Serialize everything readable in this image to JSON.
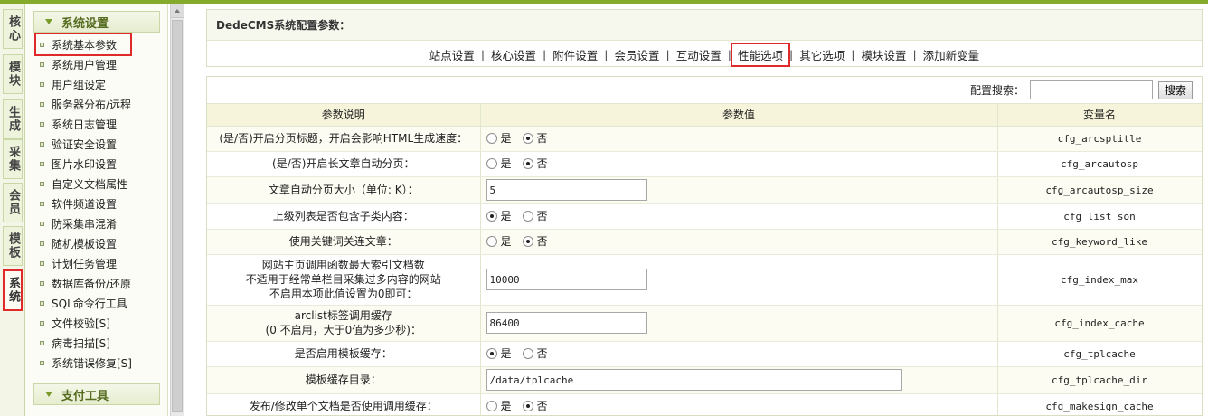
{
  "vtabs": [
    {
      "label": "核心",
      "active": false
    },
    {
      "label": "模块",
      "active": false
    },
    {
      "label": "生成",
      "active": false
    },
    {
      "label": "采集",
      "active": false
    },
    {
      "label": "会员",
      "active": false
    },
    {
      "label": "模板",
      "active": false
    },
    {
      "label": "系统",
      "active": true
    }
  ],
  "sidebar": {
    "section_title": "系统设置",
    "items": [
      {
        "label": "系统基本参数"
      },
      {
        "label": "系统用户管理"
      },
      {
        "label": "用户组设定"
      },
      {
        "label": "服务器分布/远程"
      },
      {
        "label": "系统日志管理"
      },
      {
        "label": "验证安全设置"
      },
      {
        "label": "图片水印设置"
      },
      {
        "label": "自定义文档属性"
      },
      {
        "label": "软件频道设置"
      },
      {
        "label": "防采集串混淆"
      },
      {
        "label": "随机模板设置"
      },
      {
        "label": "计划任务管理"
      },
      {
        "label": "数据库备份/还原"
      },
      {
        "label": "SQL命令行工具"
      },
      {
        "label": "文件校验[S]"
      },
      {
        "label": "病毒扫描[S]"
      },
      {
        "label": "系统错误修复[S]"
      }
    ],
    "section2_title": "支付工具"
  },
  "main": {
    "title": "DedeCMS系统配置参数：",
    "tabs": [
      {
        "label": "站点设置"
      },
      {
        "label": "核心设置"
      },
      {
        "label": "附件设置"
      },
      {
        "label": "会员设置"
      },
      {
        "label": "互动设置"
      },
      {
        "label": "性能选项"
      },
      {
        "label": "其它选项"
      },
      {
        "label": "模块设置"
      },
      {
        "label": "添加新变量"
      }
    ],
    "search_label": "配置搜索：",
    "search_value": "",
    "search_button": "搜索",
    "columns": [
      "参数说明",
      "参数值",
      "变量名"
    ],
    "radio_yes": "是",
    "radio_no": "否",
    "rows": [
      {
        "desc": [
          "(是/否)开启分页标题，开启会影响HTML生成速度："
        ],
        "type": "radio",
        "value": "否",
        "var": "cfg_arcsptitle"
      },
      {
        "desc": [
          "(是/否)开启长文章自动分页："
        ],
        "type": "radio",
        "value": "否",
        "var": "cfg_arcautosp"
      },
      {
        "desc": [
          "文章自动分页大小（单位: K）："
        ],
        "type": "text",
        "value": "5",
        "var": "cfg_arcautosp_size"
      },
      {
        "desc": [
          "上级列表是否包含子类内容："
        ],
        "type": "radio",
        "value": "是",
        "var": "cfg_list_son"
      },
      {
        "desc": [
          "使用关键词关连文章："
        ],
        "type": "radio",
        "value": "否",
        "var": "cfg_keyword_like"
      },
      {
        "desc": [
          "网站主页调用函数最大索引文档数",
          "不适用于经常单栏目采集过多内容的网站",
          "不启用本项此值设置为0即可："
        ],
        "type": "text",
        "value": "10000",
        "var": "cfg_index_max"
      },
      {
        "desc": [
          "arclist标签调用缓存",
          "(0 不启用，大于0值为多少秒)："
        ],
        "type": "text",
        "value": "86400",
        "var": "cfg_index_cache"
      },
      {
        "desc": [
          "是否启用模板缓存："
        ],
        "type": "radio",
        "value": "是",
        "var": "cfg_tplcache"
      },
      {
        "desc": [
          "模板缓存目录："
        ],
        "type": "textwide",
        "value": "/data/tplcache",
        "var": "cfg_tplcache_dir"
      },
      {
        "desc": [
          "发布/修改单个文档是否使用调用缓存："
        ],
        "type": "radio",
        "value": "否",
        "var": "cfg_makesign_cache"
      }
    ]
  }
}
